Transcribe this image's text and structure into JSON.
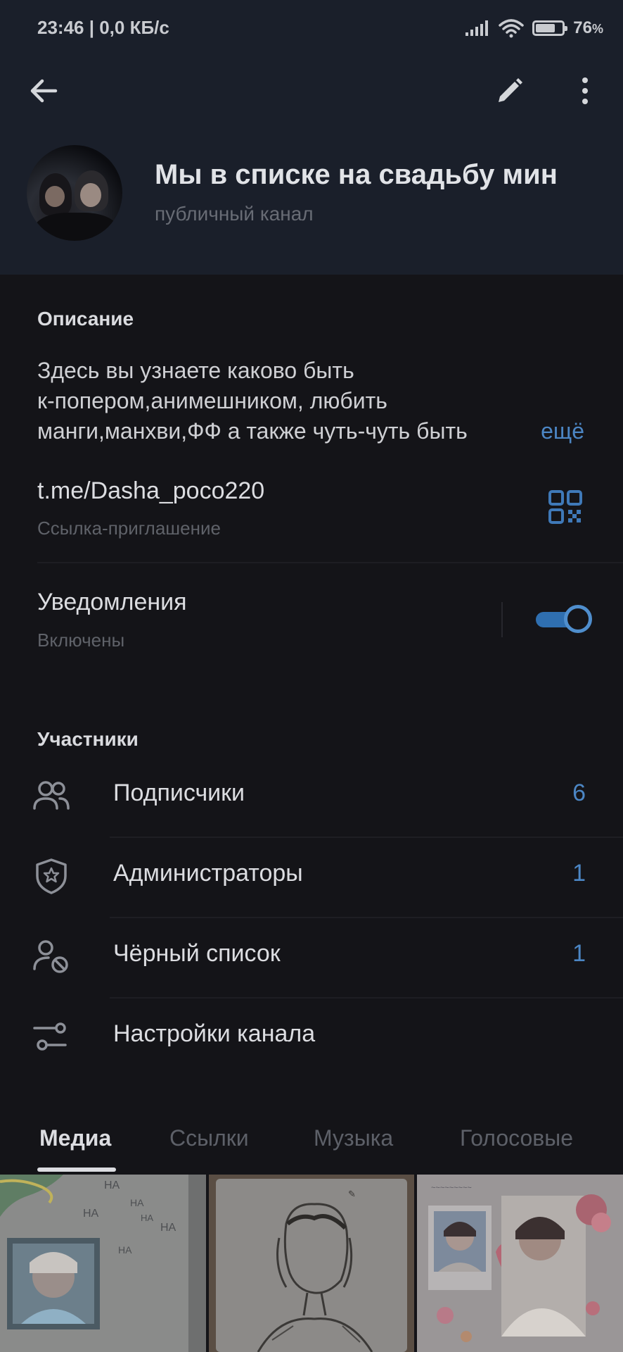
{
  "status_bar": {
    "time": "23:46 | 0,0 КБ/с",
    "battery_percent": "76",
    "battery_suffix": "%",
    "battery_level": 0.76
  },
  "header": {
    "back_icon": "arrow-left-icon",
    "edit_icon": "pencil-icon",
    "more_icon": "more-vertical-icon",
    "title": "Мы в списке на свадьбу мин",
    "subtitle": "публичный канал"
  },
  "description": {
    "label": "Описание",
    "lines": [
      "Здесь вы узнаете каково быть",
      "к-попером,анимешником, любить",
      "манги,манхви,ФФ а также чуть-чуть быть"
    ],
    "more": "ещё"
  },
  "link": {
    "url": "t.me/Dasha_poco220",
    "label": "Ссылка-приглашение",
    "icon": "qr-code-icon"
  },
  "notifications": {
    "label": "Уведомления",
    "status": "Включены",
    "enabled": true
  },
  "members": {
    "label": "Участники",
    "items": [
      {
        "icon": "users-icon",
        "label": "Подписчики",
        "count": "6"
      },
      {
        "icon": "shield-star-icon",
        "label": "Администраторы",
        "count": "1"
      },
      {
        "icon": "user-blocked-icon",
        "label": "Чёрный список",
        "count": "1"
      },
      {
        "icon": "sliders-icon",
        "label": "Настройки канала",
        "count": ""
      }
    ]
  },
  "tabs": [
    {
      "label": "Медиа",
      "active": true
    },
    {
      "label": "Ссылки",
      "active": false
    },
    {
      "label": "Музыка",
      "active": false
    },
    {
      "label": "Голосовые",
      "active": false
    }
  ],
  "colors": {
    "header_bg": "#1a1f2a",
    "body_bg": "#141418",
    "accent": "#4c86c4"
  }
}
